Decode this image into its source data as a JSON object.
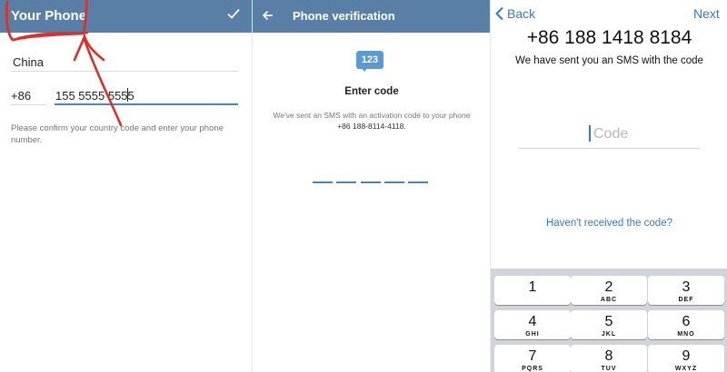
{
  "panel1": {
    "title": "Your Phone",
    "confirm_icon": "checkmark-icon",
    "country": "China",
    "country_code": "+86",
    "phone": "155 5555 5555",
    "help_text": "Please confirm your country code and enter your phone number.",
    "annotation_color": "#d9322a"
  },
  "panel2": {
    "title": "Phone verification",
    "back_icon": "arrow-left-icon",
    "badge": "123",
    "heading": "Enter code",
    "sent_text": "We've sent an SMS with an activation code to your phone",
    "sent_number": "+86 188-8114-4118."
  },
  "panel3": {
    "back_label": "Back",
    "next_label": "Next",
    "phone_number": "+86 188 1418 8184",
    "sms_text": "We have sent you an SMS with the code",
    "code_placeholder": "Code",
    "resend_label": "Haven't received the code?",
    "keys": [
      {
        "digit": "1",
        "letters": ""
      },
      {
        "digit": "2",
        "letters": "ABC"
      },
      {
        "digit": "3",
        "letters": "DEF"
      },
      {
        "digit": "4",
        "letters": "GHI"
      },
      {
        "digit": "5",
        "letters": "JKL"
      },
      {
        "digit": "6",
        "letters": "MNO"
      },
      {
        "digit": "7",
        "letters": "PQRS"
      },
      {
        "digit": "8",
        "letters": "TUV"
      },
      {
        "digit": "9",
        "letters": "WXYZ"
      }
    ]
  },
  "colors": {
    "header_bar": "#5a7fa6",
    "accent_blue": "#2e7bd6",
    "keyboard_bg": "#d1d4d9"
  }
}
